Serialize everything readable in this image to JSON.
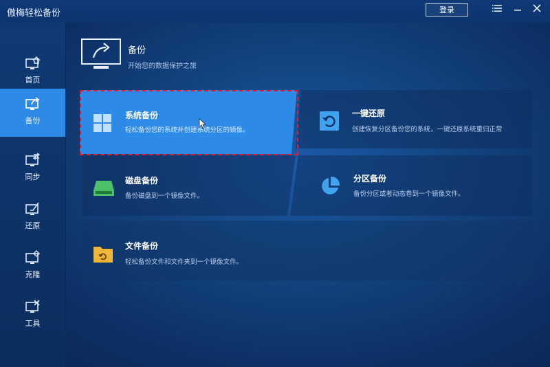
{
  "app": {
    "title": "傲梅轻松备份",
    "login_label": "登录"
  },
  "icons": {
    "menu": "menu-icon",
    "minimize": "minimize-icon",
    "close": "close-icon"
  },
  "sidebar": {
    "items": [
      {
        "label": "首页",
        "icon": "home-icon",
        "active": false
      },
      {
        "label": "备份",
        "icon": "backup-icon",
        "active": true
      },
      {
        "label": "同步",
        "icon": "sync-icon",
        "active": false
      },
      {
        "label": "还原",
        "icon": "restore-icon",
        "active": false
      },
      {
        "label": "克隆",
        "icon": "clone-icon",
        "active": false
      },
      {
        "label": "工具",
        "icon": "tools-icon",
        "active": false
      }
    ]
  },
  "header": {
    "title": "备份",
    "subtitle": "开始您的数据保护之旅"
  },
  "cards": {
    "system": {
      "title": "系统备份",
      "desc": "轻松备份您的系统并创建系统分区的镜像。"
    },
    "onekey": {
      "title": "一键还原",
      "desc": "创建恢复分区备份您的系统，一键还原系统重归正常"
    },
    "disk": {
      "title": "磁盘备份",
      "desc": "备份磁盘到一个镜像文件。"
    },
    "partition": {
      "title": "分区备份",
      "desc": "备份分区或者动态卷到一个镜像文件。"
    },
    "file": {
      "title": "文件备份",
      "desc": "轻松备份文件和文件夹到一个镜像文件。"
    }
  },
  "colors": {
    "accent": "#2d8ae6",
    "selection_outline": "#e21b2e",
    "disk_icon": "#4fc06a",
    "file_icon": "#f0b63c",
    "partition_icon": "#3fa3ef"
  }
}
